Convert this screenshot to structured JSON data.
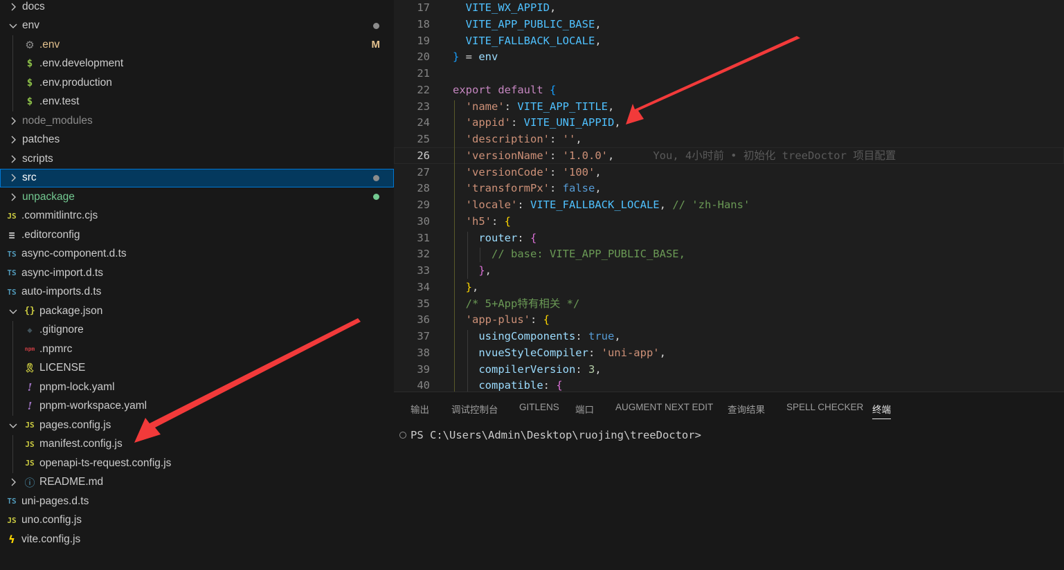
{
  "explorer": {
    "items": [
      {
        "label": "docs",
        "kind": "folder",
        "state": "collapsed",
        "icon": "chevron-right-icon",
        "file_icon": "",
        "color": "#cccccc",
        "badge": "",
        "dot": false,
        "indent": 0
      },
      {
        "label": "env",
        "kind": "folder",
        "state": "expanded",
        "icon": "chevron-down-icon",
        "file_icon": "",
        "color": "#cccccc",
        "badge": "",
        "dot": true,
        "indent": 0
      },
      {
        "label": ".env",
        "kind": "file",
        "file_icon": "gear-icon",
        "color": "#e2c08d",
        "badge": "M",
        "dot": false,
        "indent": 1
      },
      {
        "label": ".env.development",
        "kind": "file",
        "file_icon": "dollar-icon",
        "color": "#cccccc",
        "badge": "",
        "dot": false,
        "indent": 1
      },
      {
        "label": ".env.production",
        "kind": "file",
        "file_icon": "dollar-icon",
        "color": "#cccccc",
        "badge": "",
        "dot": false,
        "indent": 1
      },
      {
        "label": ".env.test",
        "kind": "file",
        "file_icon": "dollar-icon",
        "color": "#cccccc",
        "badge": "",
        "dot": false,
        "indent": 1
      },
      {
        "label": "node_modules",
        "kind": "folder",
        "state": "collapsed",
        "icon": "chevron-right-icon",
        "file_icon": "",
        "color": "#8c8c8c",
        "badge": "",
        "dot": false,
        "indent": 0
      },
      {
        "label": "patches",
        "kind": "folder",
        "state": "collapsed",
        "icon": "chevron-right-icon",
        "file_icon": "",
        "color": "#cccccc",
        "badge": "",
        "dot": false,
        "indent": 0
      },
      {
        "label": "scripts",
        "kind": "folder",
        "state": "collapsed",
        "icon": "chevron-right-icon",
        "file_icon": "",
        "color": "#cccccc",
        "badge": "",
        "dot": false,
        "indent": 0
      },
      {
        "label": "src",
        "kind": "folder",
        "state": "collapsed",
        "icon": "chevron-right-icon",
        "file_icon": "",
        "color": "#ffffff",
        "badge": "",
        "dot": true,
        "indent": 0,
        "selected": true
      },
      {
        "label": "unpackage",
        "kind": "folder",
        "state": "collapsed",
        "icon": "chevron-right-icon",
        "file_icon": "",
        "color": "#73c991",
        "badge": "",
        "dot": true,
        "dot_color": "#73c991",
        "indent": 0
      },
      {
        "label": ".commitlintrc.cjs",
        "kind": "file",
        "file_icon": "js-icon",
        "color": "#cccccc",
        "badge": "",
        "dot": false,
        "indent": 0
      },
      {
        "label": ".editorconfig",
        "kind": "file",
        "file_icon": "lines-icon",
        "color": "#cccccc",
        "badge": "",
        "dot": false,
        "indent": 0
      },
      {
        "label": "async-component.d.ts",
        "kind": "file",
        "file_icon": "ts-icon",
        "color": "#cccccc",
        "badge": "",
        "dot": false,
        "indent": 0
      },
      {
        "label": "async-import.d.ts",
        "kind": "file",
        "file_icon": "ts-icon",
        "color": "#cccccc",
        "badge": "",
        "dot": false,
        "indent": 0
      },
      {
        "label": "auto-imports.d.ts",
        "kind": "file",
        "file_icon": "ts-icon",
        "color": "#cccccc",
        "badge": "",
        "dot": false,
        "indent": 0
      },
      {
        "label": "package.json",
        "kind": "nest",
        "state": "expanded",
        "icon": "chevron-down-icon",
        "file_icon": "braces-icon",
        "color": "#cccccc",
        "badge": "",
        "dot": false,
        "indent": 0
      },
      {
        "label": ".gitignore",
        "kind": "file",
        "file_icon": "diamond-icon",
        "color": "#cccccc",
        "badge": "",
        "dot": false,
        "indent": 1
      },
      {
        "label": ".npmrc",
        "kind": "file",
        "file_icon": "npm-icon",
        "color": "#cccccc",
        "badge": "",
        "dot": false,
        "indent": 1
      },
      {
        "label": "LICENSE",
        "kind": "file",
        "file_icon": "license-icon",
        "color": "#cccccc",
        "badge": "",
        "dot": false,
        "indent": 1
      },
      {
        "label": "pnpm-lock.yaml",
        "kind": "file",
        "file_icon": "exclaim-icon",
        "color": "#cccccc",
        "badge": "",
        "dot": false,
        "indent": 1
      },
      {
        "label": "pnpm-workspace.yaml",
        "kind": "file",
        "file_icon": "exclaim-icon",
        "color": "#cccccc",
        "badge": "",
        "dot": false,
        "indent": 1
      },
      {
        "label": "pages.config.js",
        "kind": "nest",
        "state": "expanded",
        "icon": "chevron-down-icon",
        "file_icon": "js-icon",
        "color": "#cccccc",
        "badge": "",
        "dot": false,
        "indent": 0
      },
      {
        "label": "manifest.config.js",
        "kind": "file",
        "file_icon": "js-icon",
        "color": "#cccccc",
        "badge": "",
        "dot": false,
        "indent": 1
      },
      {
        "label": "openapi-ts-request.config.js",
        "kind": "file",
        "file_icon": "js-icon",
        "color": "#cccccc",
        "badge": "",
        "dot": false,
        "indent": 1
      },
      {
        "label": "README.md",
        "kind": "nest",
        "state": "collapsed",
        "icon": "chevron-right-icon",
        "file_icon": "info-icon",
        "color": "#cccccc",
        "badge": "",
        "dot": false,
        "indent": 0
      },
      {
        "label": "uni-pages.d.ts",
        "kind": "file",
        "file_icon": "ts-icon",
        "color": "#cccccc",
        "badge": "",
        "dot": false,
        "indent": 0
      },
      {
        "label": "uno.config.js",
        "kind": "file",
        "file_icon": "js-icon",
        "color": "#cccccc",
        "badge": "",
        "dot": false,
        "indent": 0
      },
      {
        "label": "vite.config.js",
        "kind": "file",
        "file_icon": "bolt-icon",
        "color": "#cccccc",
        "badge": "",
        "dot": false,
        "indent": 0
      }
    ]
  },
  "editor": {
    "current_line": 26,
    "blame": "You, 4小时前 • 初始化 treeDoctor 项目配置",
    "lines": [
      {
        "n": "17",
        "t": [
          [
            "  ",
            ""
          ],
          [
            "VITE_WX_APPID",
            "#4fc1ff"
          ],
          [
            ",",
            "#d4d4d4"
          ]
        ]
      },
      {
        "n": "18",
        "t": [
          [
            "  ",
            ""
          ],
          [
            "VITE_APP_PUBLIC_BASE",
            "#4fc1ff"
          ],
          [
            ",",
            "#d4d4d4"
          ]
        ]
      },
      {
        "n": "19",
        "t": [
          [
            "  ",
            ""
          ],
          [
            "VITE_FALLBACK_LOCALE",
            "#4fc1ff"
          ],
          [
            ",",
            "#d4d4d4"
          ]
        ]
      },
      {
        "n": "20",
        "t": [
          [
            "}",
            "#179fff"
          ],
          [
            " = ",
            "#d4d4d4"
          ],
          [
            "env",
            "#9cdcfe"
          ]
        ]
      },
      {
        "n": "21",
        "t": []
      },
      {
        "n": "22",
        "t": [
          [
            "export default ",
            "#c586c0"
          ],
          [
            "{",
            "#179fff"
          ]
        ]
      },
      {
        "n": "23",
        "t": [
          [
            "  ",
            ""
          ],
          [
            "'name'",
            "#ce9178"
          ],
          [
            ": ",
            "#d4d4d4"
          ],
          [
            "VITE_APP_TITLE",
            "#4fc1ff"
          ],
          [
            ",",
            "#d4d4d4"
          ]
        ]
      },
      {
        "n": "24",
        "t": [
          [
            "  ",
            ""
          ],
          [
            "'appid'",
            "#ce9178"
          ],
          [
            ": ",
            "#d4d4d4"
          ],
          [
            "VITE_UNI_APPID",
            "#4fc1ff"
          ],
          [
            ",",
            "#d4d4d4"
          ]
        ]
      },
      {
        "n": "25",
        "t": [
          [
            "  ",
            ""
          ],
          [
            "'description'",
            "#ce9178"
          ],
          [
            ": ",
            "#d4d4d4"
          ],
          [
            "''",
            "#ce9178"
          ],
          [
            ",",
            "#d4d4d4"
          ]
        ]
      },
      {
        "n": "26",
        "t": [
          [
            "  ",
            ""
          ],
          [
            "'versionName'",
            "#ce9178"
          ],
          [
            ": ",
            "#d4d4d4"
          ],
          [
            "'1.0.0'",
            "#ce9178"
          ],
          [
            ",",
            "#d4d4d4"
          ]
        ]
      },
      {
        "n": "27",
        "t": [
          [
            "  ",
            ""
          ],
          [
            "'versionCode'",
            "#ce9178"
          ],
          [
            ": ",
            "#d4d4d4"
          ],
          [
            "'100'",
            "#ce9178"
          ],
          [
            ",",
            "#d4d4d4"
          ]
        ]
      },
      {
        "n": "28",
        "t": [
          [
            "  ",
            ""
          ],
          [
            "'transformPx'",
            "#ce9178"
          ],
          [
            ": ",
            "#d4d4d4"
          ],
          [
            "false",
            "#569cd6"
          ],
          [
            ",",
            "#d4d4d4"
          ]
        ]
      },
      {
        "n": "29",
        "t": [
          [
            "  ",
            ""
          ],
          [
            "'locale'",
            "#ce9178"
          ],
          [
            ": ",
            "#d4d4d4"
          ],
          [
            "VITE_FALLBACK_LOCALE",
            "#4fc1ff"
          ],
          [
            ", ",
            "#d4d4d4"
          ],
          [
            "// 'zh-Hans'",
            "#6a9955"
          ]
        ]
      },
      {
        "n": "30",
        "t": [
          [
            "  ",
            ""
          ],
          [
            "'h5'",
            "#ce9178"
          ],
          [
            ": ",
            "#d4d4d4"
          ],
          [
            "{",
            "#ffd700"
          ]
        ]
      },
      {
        "n": "31",
        "t": [
          [
            "    ",
            ""
          ],
          [
            "router",
            "#9cdcfe"
          ],
          [
            ": ",
            "#d4d4d4"
          ],
          [
            "{",
            "#da70d6"
          ]
        ]
      },
      {
        "n": "32",
        "t": [
          [
            "      ",
            ""
          ],
          [
            "// base: VITE_APP_PUBLIC_BASE,",
            "#6a9955"
          ]
        ]
      },
      {
        "n": "33",
        "t": [
          [
            "    ",
            ""
          ],
          [
            "}",
            "#da70d6"
          ],
          [
            ",",
            "#d4d4d4"
          ]
        ]
      },
      {
        "n": "34",
        "t": [
          [
            "  ",
            ""
          ],
          [
            "}",
            "#ffd700"
          ],
          [
            ",",
            "#d4d4d4"
          ]
        ]
      },
      {
        "n": "35",
        "t": [
          [
            "  ",
            ""
          ],
          [
            "/* 5+App特有相关 */",
            "#6a9955"
          ]
        ]
      },
      {
        "n": "36",
        "t": [
          [
            "  ",
            ""
          ],
          [
            "'app-plus'",
            "#ce9178"
          ],
          [
            ": ",
            "#d4d4d4"
          ],
          [
            "{",
            "#ffd700"
          ]
        ]
      },
      {
        "n": "37",
        "t": [
          [
            "    ",
            ""
          ],
          [
            "usingComponents",
            "#9cdcfe"
          ],
          [
            ": ",
            "#d4d4d4"
          ],
          [
            "true",
            "#569cd6"
          ],
          [
            ",",
            "#d4d4d4"
          ]
        ]
      },
      {
        "n": "38",
        "t": [
          [
            "    ",
            ""
          ],
          [
            "nvueStyleCompiler",
            "#9cdcfe"
          ],
          [
            ": ",
            "#d4d4d4"
          ],
          [
            "'uni-app'",
            "#ce9178"
          ],
          [
            ",",
            "#d4d4d4"
          ]
        ]
      },
      {
        "n": "39",
        "t": [
          [
            "    ",
            ""
          ],
          [
            "compilerVersion",
            "#9cdcfe"
          ],
          [
            ": ",
            "#d4d4d4"
          ],
          [
            "3",
            "#b5cea8"
          ],
          [
            ",",
            "#d4d4d4"
          ]
        ]
      },
      {
        "n": "40",
        "t": [
          [
            "    ",
            ""
          ],
          [
            "compatible",
            "#9cdcfe"
          ],
          [
            ": ",
            "#d4d4d4"
          ],
          [
            "{",
            "#da70d6"
          ]
        ]
      }
    ]
  },
  "panel": {
    "tabs": [
      "输出",
      "调试控制台",
      "GITLENS",
      "端口",
      "AUGMENT NEXT EDIT",
      "查询结果",
      "SPELL CHECKER",
      "终端"
    ],
    "active_tab": "终端",
    "terminal_prompt": "PS C:\\Users\\Admin\\Desktop\\ruojing\\treeDoctor>"
  },
  "colors": {
    "annotation_arrow": "#f23a3a",
    "accent": "#0078d4",
    "js_icon": "#cbcb41",
    "ts_icon": "#519aba",
    "env_icon": "#8dc149"
  }
}
